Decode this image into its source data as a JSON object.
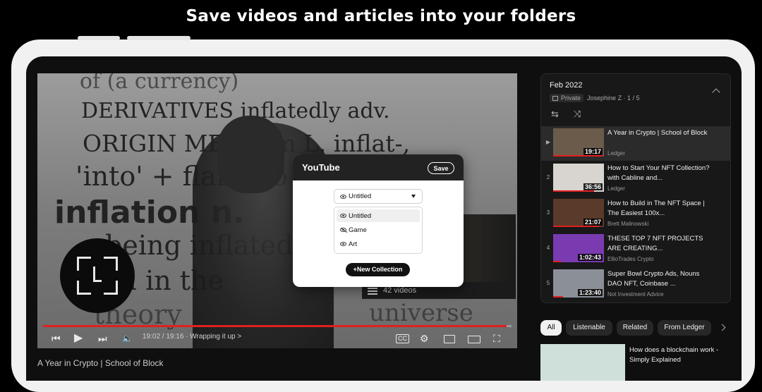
{
  "headline": "Save videos and articles into your folders",
  "player": {
    "dictionary_lines": [
      "of (a currency)",
      "DERIVATIVES inflatedly adv.",
      "ORIGIN ME: from L. inflat-,",
      "'into' + flare 'to blow'.",
      "inflation n.",
      "being inflated",
      "fall in the",
      "theory",
      "universe"
    ],
    "card_label": "42 videos",
    "time": "19:02 / 19:16 · Wrapping it up",
    "chapter_chevron": ">",
    "progress_fraction": 0.99,
    "video_title_below": "A Year in Crypto | School of Block",
    "icons": [
      "prev-icon",
      "play-icon",
      "next-icon",
      "volume-icon",
      "cc-icon",
      "settings-icon",
      "miniplayer-icon",
      "theater-icon",
      "fullscreen-icon",
      "lens-icon"
    ]
  },
  "popup": {
    "title": "YouTube",
    "save_label": "Save",
    "selected": "Untitled",
    "options": [
      {
        "label": "Untitled",
        "icon": "eye-icon"
      },
      {
        "label": "Game",
        "icon": "eye-slash-icon"
      },
      {
        "label": "Art",
        "icon": "eye-icon"
      }
    ],
    "new_collection": "+New Collection"
  },
  "playlist": {
    "title": "Feb 2022",
    "private": "Private",
    "owner": "Josephine Z · 1 / 5",
    "items": [
      {
        "index": "▶",
        "title": "A Year in Crypto | School of Block",
        "channel": "Ledger",
        "duration": "19:17",
        "progress": 0.99,
        "thumb": "#6a5b4a"
      },
      {
        "index": "2",
        "title": "How to Start Your NFT Collection? with Cabline and...",
        "channel": "Ledger",
        "duration": "36:56",
        "progress": 0.8,
        "thumb": "#d8d4cf"
      },
      {
        "index": "3",
        "title": "How to Build in The NFT Space | The Easiest 100x...",
        "channel": "Brett Malinowski",
        "duration": "21:07",
        "progress": 0.9,
        "thumb": "#5a3a2a"
      },
      {
        "index": "4",
        "title": "THESE TOP 7 NFT PROJECTS ARE CREATING...",
        "channel": "EllioTrades Crypto",
        "duration": "1:02:43",
        "progress": 0.15,
        "thumb": "#7a3bb0"
      },
      {
        "index": "5",
        "title": "Super Bowl Crypto Ads, Nouns DAO NFT, Coinbase ...",
        "channel": "Not Investment Advice",
        "duration": "1:23:40",
        "progress": 0.2,
        "thumb": "#8a8f98"
      }
    ]
  },
  "chips": [
    "All",
    "Listenable",
    "Related",
    "From Ledger"
  ],
  "recommendation": {
    "title": "How does a blockchain work - Simply Explained"
  }
}
